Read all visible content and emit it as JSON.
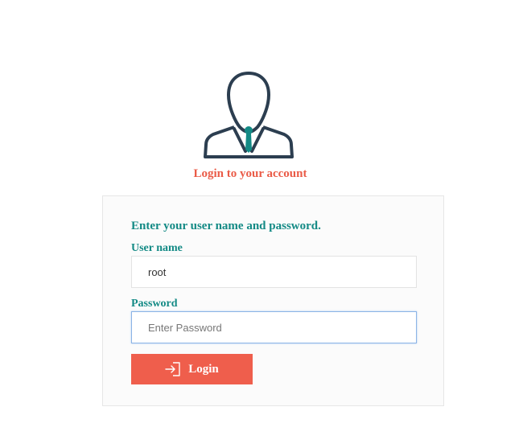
{
  "header": {
    "avatar_icon": "user-with-tie-icon",
    "title": "Login to your account"
  },
  "form": {
    "instructions": "Enter your user name and password.",
    "username": {
      "label": "User name",
      "value": "root"
    },
    "password": {
      "label": "Password",
      "value": "",
      "placeholder": "Enter Password"
    },
    "login_button": {
      "label": "Login",
      "icon": "sign-in-icon"
    }
  },
  "colors": {
    "accent": "#ef5e4c",
    "heading": "#ea5b47",
    "label": "#138a85",
    "icon_stroke": "#2c3e50",
    "tie": "#138a85"
  }
}
